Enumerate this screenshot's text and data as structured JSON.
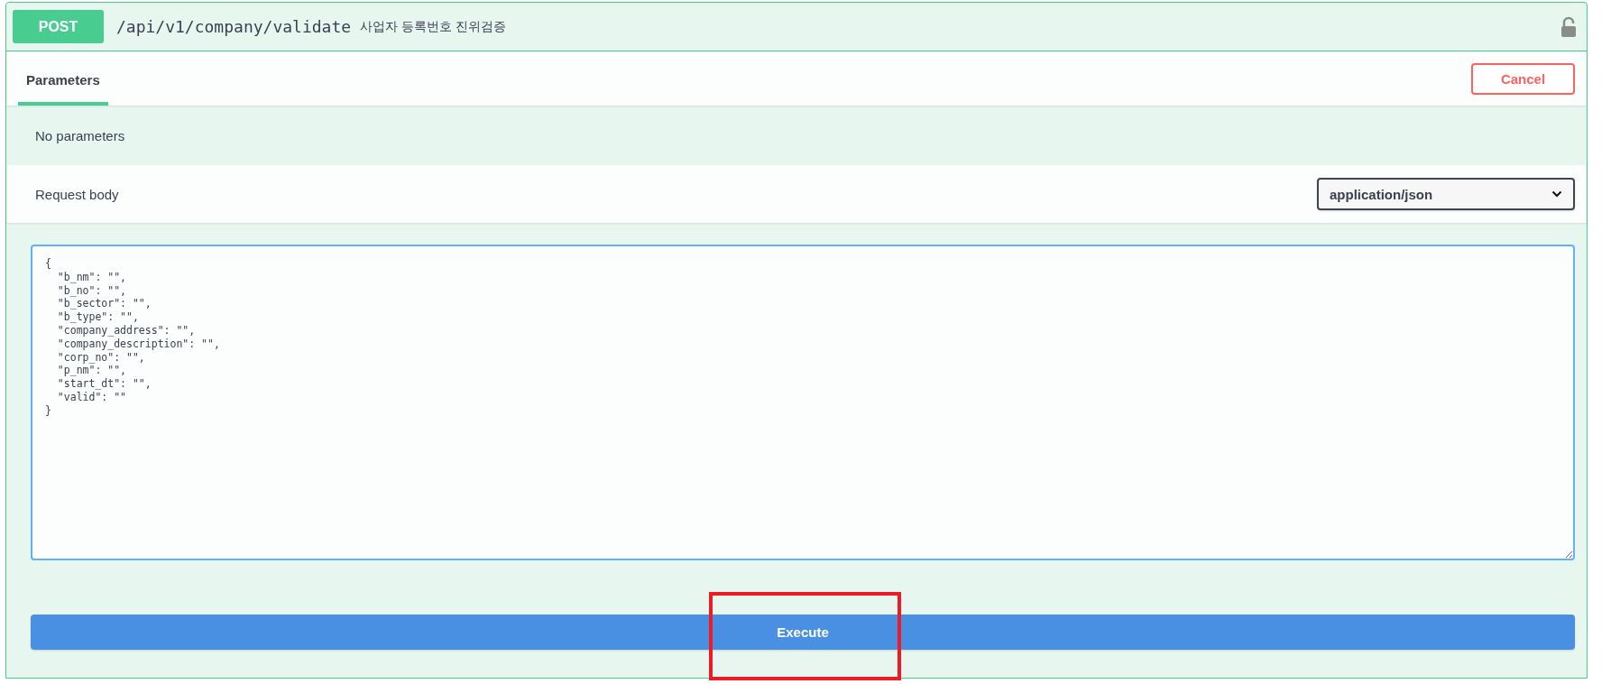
{
  "operation": {
    "method": "POST",
    "path": "/api/v1/company/validate",
    "summary": "사업자 등록번호 진위검증",
    "locked": false
  },
  "tabs": [
    {
      "label": "Parameters",
      "selected": true
    }
  ],
  "cancel_button": "Cancel",
  "parameters_message": "No parameters",
  "request_body": {
    "label": "Request body",
    "content_type": "application/json",
    "value": "{\n  \"b_nm\": \"\",\n  \"b_no\": \"\",\n  \"b_sector\": \"\",\n  \"b_type\": \"\",\n  \"company_address\": \"\",\n  \"company_description\": \"\",\n  \"corp_no\": \"\",\n  \"p_nm\": \"\",\n  \"start_dt\": \"\",\n  \"valid\": \"\"\n}"
  },
  "execute_button": "Execute"
}
